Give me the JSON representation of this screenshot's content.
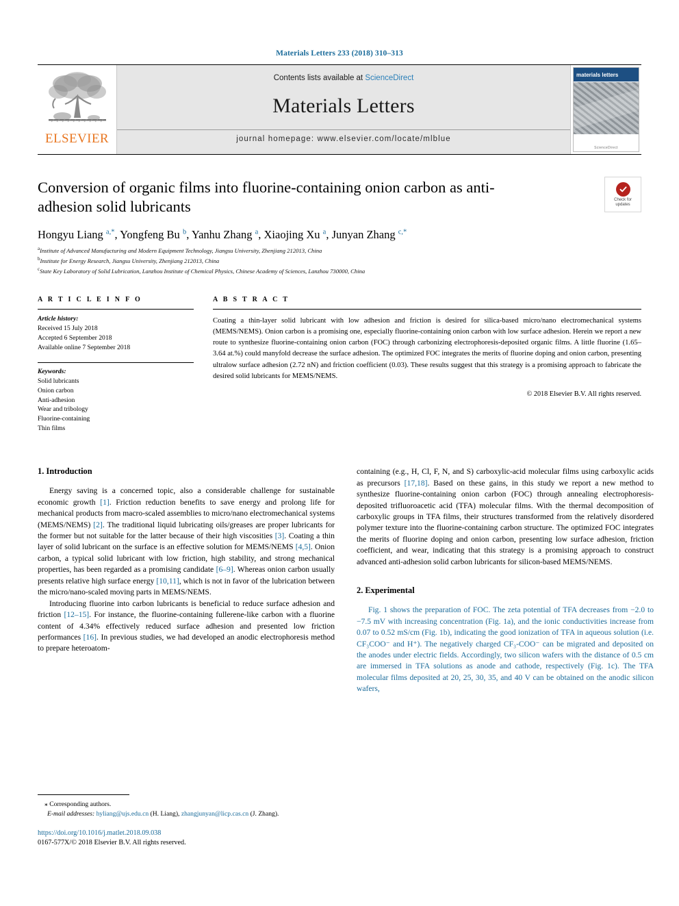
{
  "running_head": "Materials Letters 233 (2018) 310–313",
  "masthead": {
    "publisher_name": "ELSEVIER",
    "contents_prefix": "Contents lists available at ",
    "contents_link": "ScienceDirect",
    "journal_title": "Materials Letters",
    "homepage": "journal homepage: www.elsevier.com/locate/mlblue",
    "cover_title": "materials letters",
    "cover_footer": "ScienceDirect"
  },
  "article": {
    "title": "Conversion of organic films into fluorine-containing onion carbon as anti-adhesion solid lubricants",
    "crossmark_line1": "Check for",
    "crossmark_line2": "updates",
    "authors_html": "Hongyu Liang <sup>a,</sup><sup>*</sup>, Yongfeng Bu <sup>b</sup>, Yanhu Zhang <sup>a</sup>, Xiaojing Xu <sup>a</sup>, Junyan Zhang <sup>c,</sup><sup>*</sup>",
    "affiliations": [
      {
        "label": "a",
        "text": "Institute of Advanced Manufacturing and Modern Equipment Technology, Jiangsu University, Zhenjiang 212013, China"
      },
      {
        "label": "b",
        "text": "Institute for Energy Research, Jiangsu University, Zhenjiang 212013, China"
      },
      {
        "label": "c",
        "text": "State Key Laboratory of Solid Lubrication, Lanzhou Institute of Chemical Physics, Chinese Academy of Sciences, Lanzhou 730000, China"
      }
    ]
  },
  "info": {
    "heading": "A R T I C L E   I N F O",
    "history_label": "Article history:",
    "history": [
      "Received 15 July 2018",
      "Accepted 6 September 2018",
      "Available online 7 September 2018"
    ],
    "keywords_label": "Keywords:",
    "keywords": [
      "Solid lubricants",
      "Onion carbon",
      "Anti-adhesion",
      "Wear and tribology",
      "Fluorine-containing",
      "Thin films"
    ]
  },
  "abstract": {
    "heading": "A B S T R A C T",
    "text": "Coating a thin-layer solid lubricant with low adhesion and friction is desired for silica-based micro/nano electromechanical systems (MEMS/NEMS). Onion carbon is a promising one, especially fluorine-containing onion carbon with low surface adhesion. Herein we report a new route to synthesize fluorine-containing onion carbon (FOC) through carbonizing electrophoresis-deposited organic films. A little fluorine (1.65–3.64 at.%) could manyfold decrease the surface adhesion. The optimized FOC integrates the merits of fluorine doping and onion carbon, presenting ultralow surface adhesion (2.72 nN) and friction coefficient (0.03). These results suggest that this strategy is a promising approach to fabricate the desired solid lubricants for MEMS/NEMS.",
    "copyright": "© 2018 Elsevier B.V. All rights reserved."
  },
  "sections": {
    "intro_heading": "1. Introduction",
    "intro_p1_parts": [
      "Energy saving is a concerned topic, also a considerable challenge for sustainable economic growth ",
      "[1]",
      ". Friction reduction benefits to save energy and prolong life for mechanical products from macro-scaled assemblies to micro/nano electromechanical systems (MEMS/NEMS) ",
      "[2]",
      ". The traditional liquid lubricating oils/greases are proper lubricants for the former but not suitable for the latter because of their high viscosities ",
      "[3]",
      ". Coating a thin layer of solid lubricant on the surface is an effective solution for MEMS/NEMS ",
      "[4,5]",
      ". Onion carbon, a typical solid lubricant with low friction, high stability, and strong mechanical properties, has been regarded as a promising candidate ",
      "[6–9]",
      ". Whereas onion carbon usually presents relative high surface energy ",
      "[10,11]",
      ", which is not in favor of the lubrication between the micro/nano-scaled moving parts in MEMS/NEMS."
    ],
    "intro_p2_parts": [
      "Introducing fluorine into carbon lubricants is beneficial to reduce surface adhesion and friction ",
      "[12–15]",
      ". For instance, the fluorine-containing fullerene-like carbon with a fluorine content of 4.34% effectively reduced surface adhesion and presented low friction performances ",
      "[16]",
      ". In previous studies, we had developed an anodic electrophoresis method to prepare heteroatom-"
    ],
    "intro_p3_parts": [
      "containing (e.g., H, Cl, F, N, and S) carboxylic-acid molecular films using carboxylic acids as precursors ",
      "[17,18]",
      ". Based on these gains, in this study we report a new method to synthesize fluorine-containing onion carbon (FOC) through annealing electrophoresis-deposited trifluoroacetic acid (TFA) molecular films. With the thermal decomposition of carboxylic groups in TFA films, their structures transformed from the relatively disordered polymer texture into the fluorine-containing carbon structure. The optimized FOC integrates the merits of fluorine doping and onion carbon, presenting low surface adhesion, friction coefficient, and wear, indicating that this strategy is a promising approach to construct advanced anti-adhesion solid carbon lubricants for silicon-based MEMS/NEMS."
    ],
    "exp_heading": "2. Experimental",
    "exp_p1_parts": [
      "Fig. 1",
      " shows the preparation of FOC. The zeta potential of TFA decreases from −2.0 to −7.5 mV with increasing concentration (",
      "Fig. 1",
      "a), and the ionic conductivities increase from 0.07 to 0.52 mS/cm (",
      "Fig. 1",
      "b), indicating the good ionization of TFA in aqueous solution (i.e. CF₃COO⁻ and H⁺). The negatively charged CF₃-COO⁻ can be migrated and deposited on the anodes under electric fields. Accordingly, two silicon wafers with the distance of 0.5 cm are immersed in TFA solutions as anode and cathode, respectively (",
      "Fig. 1",
      "c). The TFA molecular films deposited at 20, 25, 30, 35, and 40 V can be obtained on the anodic silicon wafers,"
    ]
  },
  "footnote": {
    "corresponding": "⁎ Corresponding authors.",
    "email_label": "E-mail addresses:",
    "email1": "hyliang@ujs.edu.cn",
    "email1_who": "(H. Liang),",
    "email2": "zhangjunyan@licp.cas.cn",
    "email2_who": "(J. Zhang).",
    "doi": "https://doi.org/10.1016/j.matlet.2018.09.038",
    "issn_line": "0167-577X/© 2018 Elsevier B.V. All rights reserved."
  },
  "colors": {
    "link_blue": "#1a6b9a",
    "sciencedirect_blue": "#2a7fb8",
    "elsevier_orange": "#E87722",
    "crossmark_red": "#b5231e"
  }
}
